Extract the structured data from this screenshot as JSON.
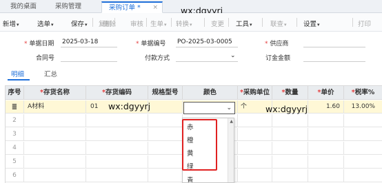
{
  "tabs": {
    "desk": "我的桌面",
    "purchase": "采购管理",
    "order": "采购订单 *",
    "close": "×"
  },
  "watermark": "wx:dgyyrj",
  "toolbar": {
    "new": "新增",
    "select": "选单",
    "save": "保存",
    "copy": "复制",
    "delete": "删除",
    "audit": "审核",
    "generate": "生单",
    "convert": "转换",
    "change": "变更",
    "tools": "工具",
    "linked": "联查",
    "settings": "设置",
    "print": "打印"
  },
  "form": {
    "date_label": "单据日期",
    "date_value": "2025-03-18",
    "number_label": "单据编号",
    "number_value": "PO-2025-03-0005",
    "supplier_label": "供应商",
    "contract_label": "合同号",
    "payment_label": "付款方式",
    "deposit_label": "订金金额"
  },
  "subtabs": {
    "detail": "明细",
    "summary": "汇总"
  },
  "grid": {
    "headers": {
      "seq": "序号",
      "name": "存货名称",
      "code": "存货编码",
      "spec": "规格型号",
      "color": "颜色",
      "unit": "采购单位",
      "qty": "数量",
      "price": "单价",
      "tax": "税率%"
    },
    "row1": {
      "name": "A材料",
      "code": "01",
      "unit": "个",
      "price": "1.60",
      "tax": "13.00%"
    },
    "row_numbers": [
      "2",
      "3",
      "4",
      "5",
      "6"
    ]
  },
  "dropdown": {
    "options": [
      "赤",
      "橙",
      "黄",
      "绿",
      "青"
    ]
  },
  "colors": {
    "accent": "#1e6fd9",
    "required": "#e43e3e",
    "highlight": "#e02020",
    "row_selected": "#fff8d6"
  }
}
